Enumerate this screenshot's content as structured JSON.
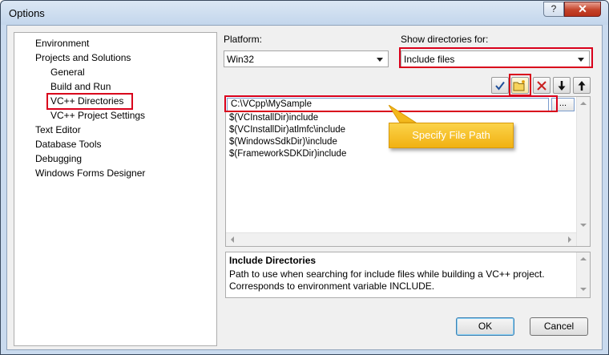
{
  "window": {
    "title": "Options",
    "help_label": "?",
    "close_label": "✕"
  },
  "tree": {
    "items": [
      {
        "label": "Environment"
      },
      {
        "label": "Projects and Solutions"
      },
      {
        "label": "General"
      },
      {
        "label": "Build and Run"
      },
      {
        "label": "VC++ Directories",
        "selected": true
      },
      {
        "label": "VC++ Project Settings"
      },
      {
        "label": "Text Editor"
      },
      {
        "label": "Database Tools"
      },
      {
        "label": "Debugging"
      },
      {
        "label": "Windows Forms Designer"
      }
    ]
  },
  "platform": {
    "label": "Platform:",
    "value": "Win32"
  },
  "show_dirs": {
    "label": "Show directories for:",
    "value": "Include files"
  },
  "toolbar": {
    "check_icon": "check-icon",
    "new_folder_icon": "new-folder-icon",
    "delete_icon": "delete-icon",
    "move_down_icon": "arrow-down-icon",
    "move_up_icon": "arrow-up-icon"
  },
  "directories": {
    "editing_value": "C:\\VCpp\\MySample",
    "browse_label": "...",
    "rows": [
      "$(VCInstallDir)include",
      "$(VCInstallDir)atlmfc\\include",
      "$(WindowsSdkDir)\\include",
      "$(FrameworkSDKDir)include"
    ]
  },
  "callout": {
    "text": "Specify File Path",
    "color": "#f4b81c"
  },
  "description": {
    "title": "Include Directories",
    "text": "Path to use when searching for include files while building a VC++ project. Corresponds to environment variable INCLUDE."
  },
  "buttons": {
    "ok": "OK",
    "cancel": "Cancel"
  },
  "colors": {
    "highlight_box": "#d9001b",
    "accent_blue": "#3c7fb1"
  }
}
